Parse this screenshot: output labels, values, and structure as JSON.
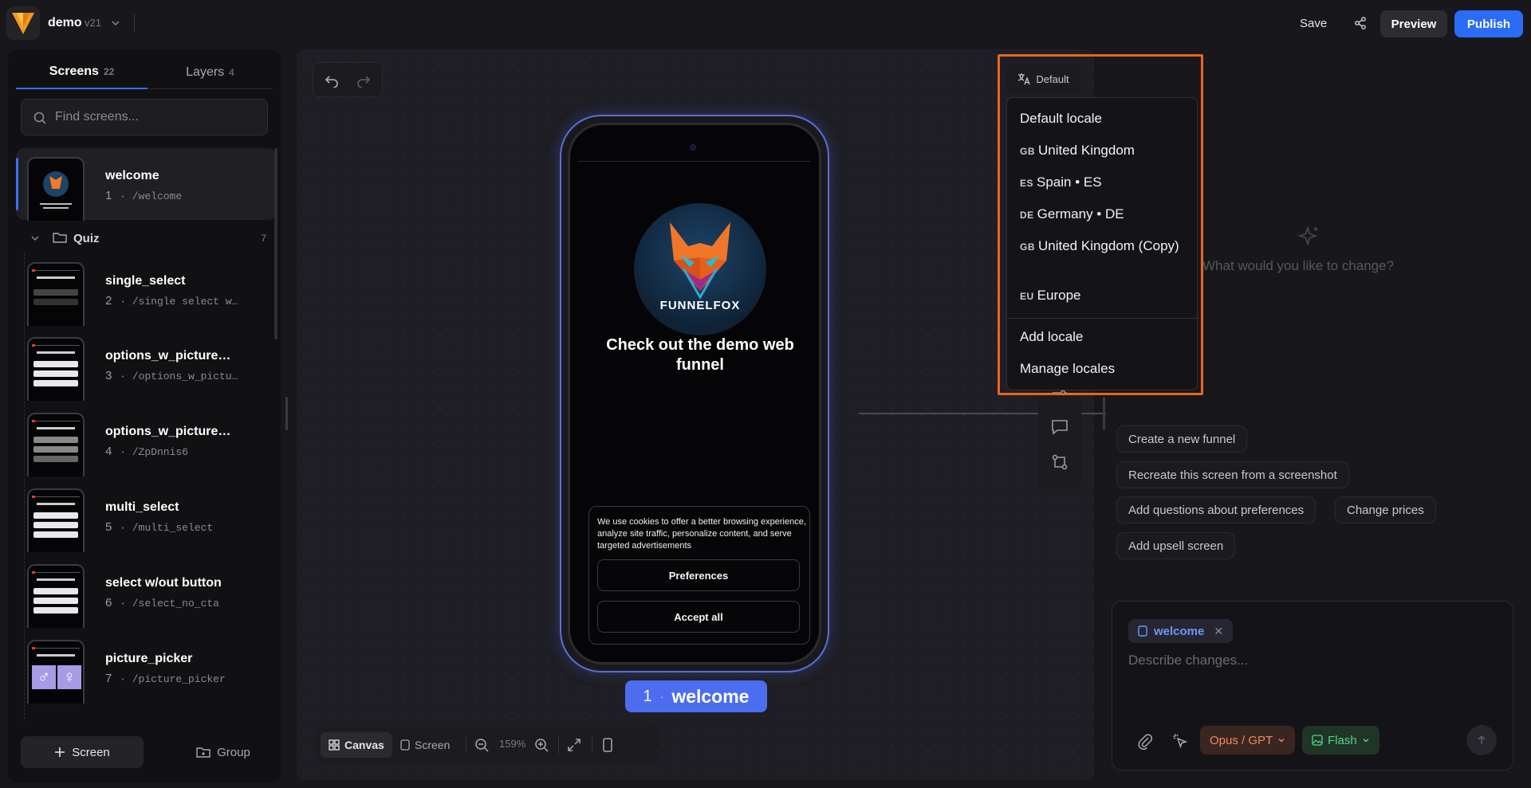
{
  "header": {
    "app_name": "demo",
    "version": "v21",
    "save_label": "Save",
    "preview_label": "Preview",
    "publish_label": "Publish"
  },
  "left_panel": {
    "tabs": [
      {
        "label": "Screens",
        "count": "22"
      },
      {
        "label": "Layers",
        "count": "4"
      }
    ],
    "search_placeholder": "Find screens...",
    "group": {
      "name": "Quiz",
      "count": "7"
    },
    "screens": [
      {
        "number": "1",
        "name": "welcome",
        "path": "/welcome"
      },
      {
        "number": "2",
        "name": "single_select",
        "path": "/single select w…"
      },
      {
        "number": "3",
        "name": "options_w_picture…",
        "path": "/options_w_pictu…"
      },
      {
        "number": "4",
        "name": "options_w_picture…",
        "path": "/ZpDnnis6"
      },
      {
        "number": "5",
        "name": "multi_select",
        "path": "/multi_select"
      },
      {
        "number": "6",
        "name": "select w/out button",
        "path": "/select_no_cta"
      },
      {
        "number": "7",
        "name": "picture_picker",
        "path": "/picture_picker"
      }
    ],
    "add_screen_label": "Screen",
    "add_group_label": "Group"
  },
  "canvas": {
    "phone": {
      "brand": "FUNNELFOX",
      "headline": "Check out the demo web funnel",
      "cookie_text": "We use cookies to offer a better browsing experience, analyze site traffic, personalize content, and serve targeted advertisements",
      "preferences_label": "Preferences",
      "accept_label": "Accept all"
    },
    "screen_label": {
      "number": "1",
      "separator": "·",
      "name": "welcome"
    },
    "toolbar": {
      "canvas_label": "Canvas",
      "screen_label": "Screen",
      "zoom": "159%"
    }
  },
  "locale": {
    "trigger_label": "Default",
    "items": [
      {
        "code": "",
        "label": "Default locale"
      },
      {
        "code": "GB",
        "label": "United Kingdom"
      },
      {
        "code": "ES",
        "label": "Spain • ES"
      },
      {
        "code": "DE",
        "label": "Germany • DE"
      },
      {
        "code": "GB",
        "label": "United Kingdom (Copy)"
      },
      {
        "code": "EU",
        "label": "Europe"
      }
    ],
    "add_label": "Add locale",
    "manage_label": "Manage locales",
    "highlight_color": "#e8661a"
  },
  "ai_panel": {
    "prompt": "What would you like to change?",
    "suggestions": [
      "Create a new funnel",
      "Recreate this screen from a screenshot",
      "Add questions about preferences",
      "Change prices",
      "Add upsell screen"
    ],
    "context_chip": "welcome",
    "input_placeholder": "Describe changes...",
    "model_label": "Opus / GPT",
    "flash_label": "Flash"
  },
  "colors": {
    "accent": "#2a6cf6",
    "screen_label": "#4d6df0"
  }
}
